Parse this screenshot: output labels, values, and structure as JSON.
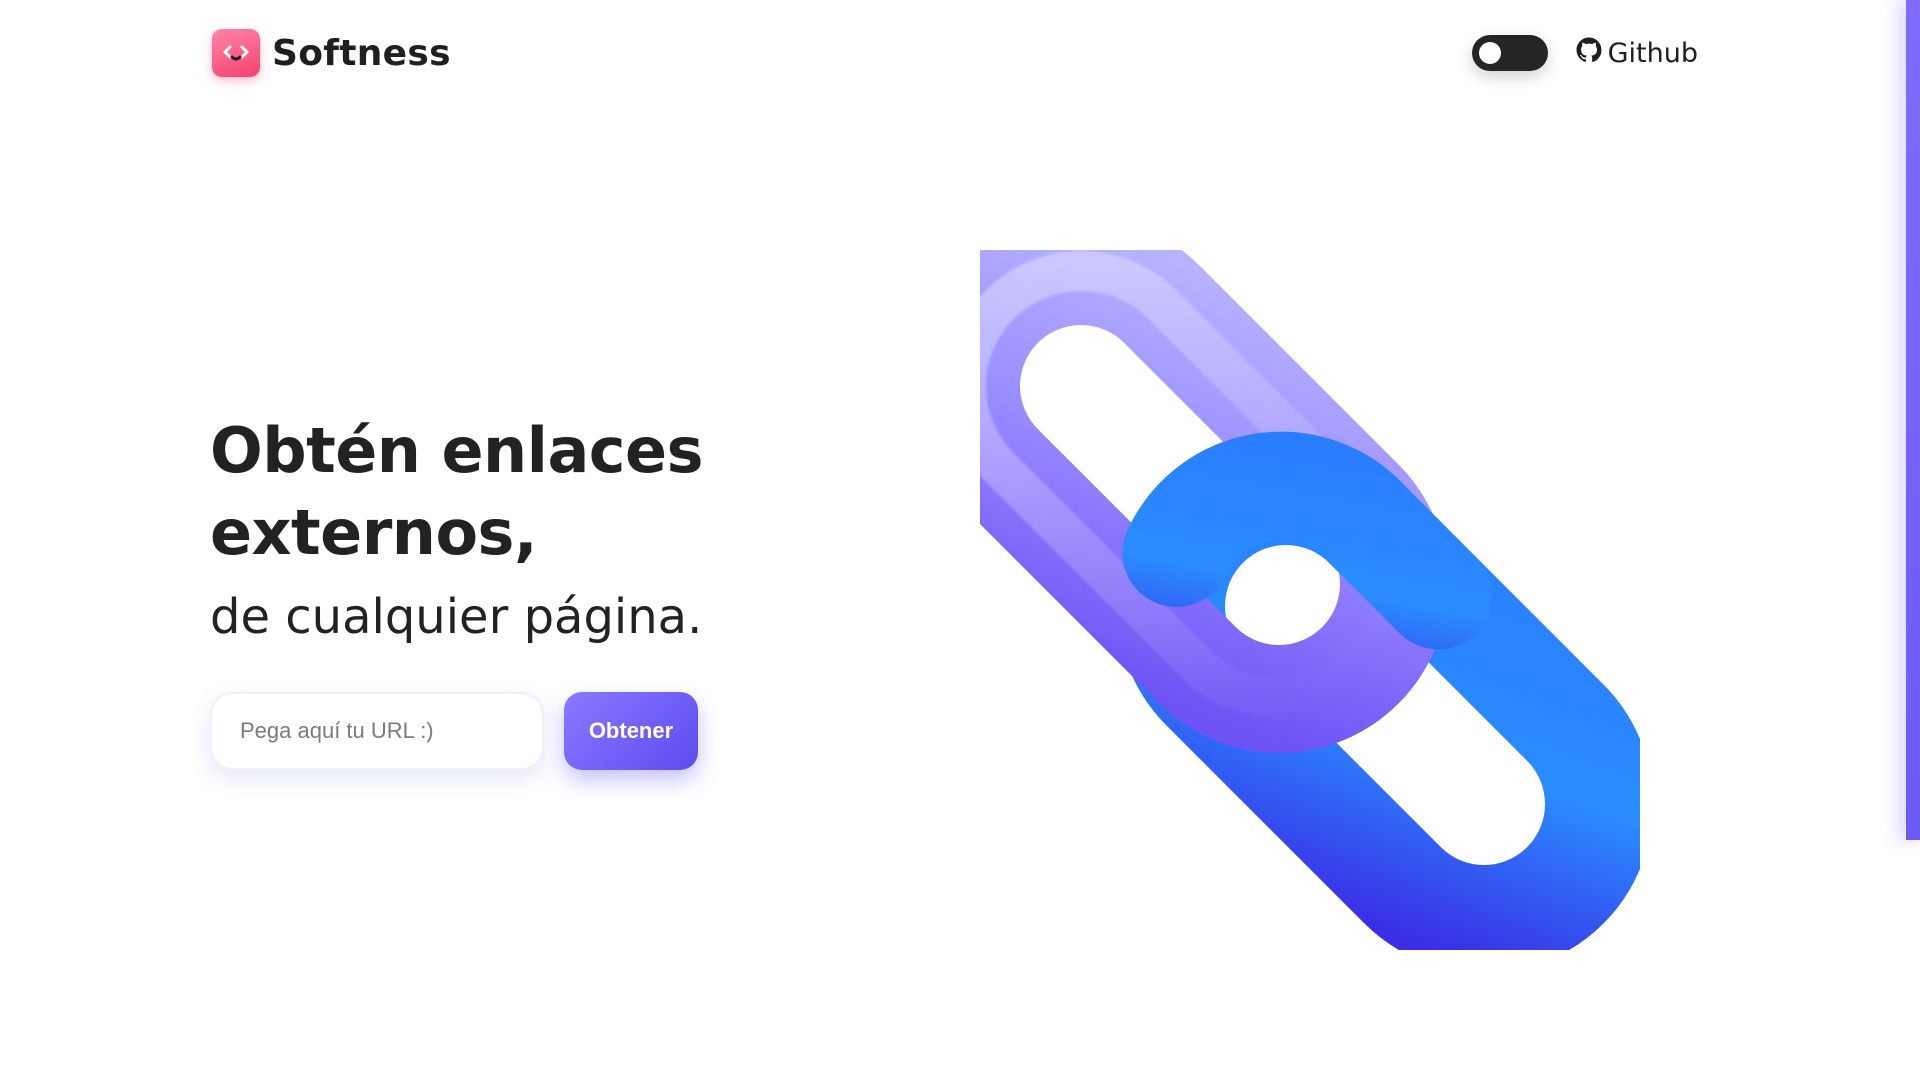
{
  "header": {
    "brand_name": "Softness",
    "github_label": "Github"
  },
  "hero": {
    "headline_line1": "Obtén enlaces",
    "headline_line2": "externos,",
    "subheadline": "de cualquier página."
  },
  "form": {
    "url_placeholder": "Pega aquí tu URL :)",
    "url_value": "",
    "submit_label": "Obtener"
  },
  "colors": {
    "brand_pink": "#f3416f",
    "accent_purple": "#6b5af5",
    "link_blue": "#2f7bff",
    "toggle_dark": "#252527"
  },
  "icons": {
    "logo": "smile-code-icon",
    "toggle": "theme-toggle",
    "github": "github-icon",
    "illustration": "chain-link-icon"
  },
  "theme_toggle": {
    "dark_mode_on": false
  }
}
